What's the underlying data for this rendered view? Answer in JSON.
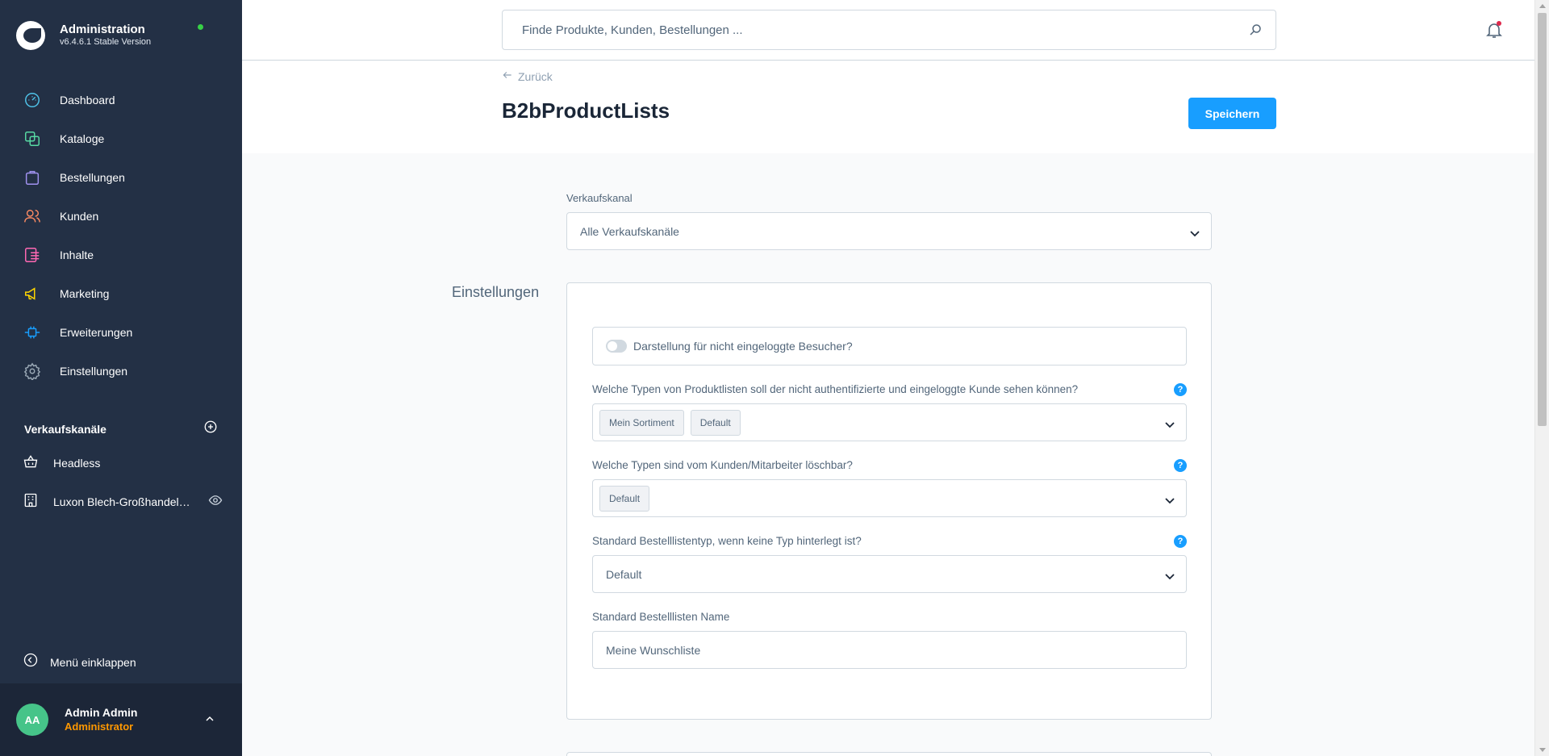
{
  "brand": {
    "title": "Administration",
    "version": "v6.4.6.1 Stable Version",
    "status_color": "#37d046"
  },
  "nav": [
    {
      "label": "Dashboard",
      "icon": "dashboard-icon",
      "color": "#189eff"
    },
    {
      "label": "Kataloge",
      "icon": "catalog-icon",
      "color": "#57d9a3"
    },
    {
      "label": "Bestellungen",
      "icon": "orders-icon",
      "color": "#a092f0"
    },
    {
      "label": "Kunden",
      "icon": "customers-icon",
      "color": "#f88962"
    },
    {
      "label": "Inhalte",
      "icon": "content-icon",
      "color": "#ff68b4"
    },
    {
      "label": "Marketing",
      "icon": "marketing-icon",
      "color": "#ffd700"
    },
    {
      "label": "Erweiterungen",
      "icon": "extensions-icon",
      "color": "#189eff"
    },
    {
      "label": "Einstellungen",
      "icon": "settings-icon",
      "color": "#9aa8b5"
    }
  ],
  "sales_channels": {
    "title": "Verkaufskanäle",
    "items": [
      {
        "label": "Headless",
        "icon": "basket-icon"
      },
      {
        "label": "Luxon Blech-Großhandel GmbH",
        "icon": "storefront-icon"
      }
    ]
  },
  "collapse_label": "Menü einklappen",
  "user": {
    "initials": "AA",
    "name": "Admin Admin",
    "role": "Administrator"
  },
  "search": {
    "placeholder": "Finde Produkte, Kunden, Bestellungen ..."
  },
  "header": {
    "back_label": "Zurück",
    "title": "B2bProductLists",
    "save_label": "Speichern"
  },
  "sales_channel_select": {
    "label": "Verkaufskanal",
    "value": "Alle Verkaufskanäle"
  },
  "settings_card": {
    "title": "Einstellungen",
    "toggle_label": "Darstellung für nicht eingeloggte Besucher?",
    "field1": {
      "label": "Welche Typen von Produktlisten soll der nicht authentifizierte und eingeloggte Kunde sehen können?",
      "tags": [
        "Mein Sortiment",
        "Default"
      ]
    },
    "field2": {
      "label": "Welche Typen sind vom Kunden/Mitarbeiter löschbar?",
      "tags": [
        "Default"
      ]
    },
    "field3": {
      "label": "Standard Bestelllistentyp, wenn keine Typ hinterlegt ist?",
      "value": "Default"
    },
    "field4": {
      "label": "Standard Bestelllisten Name",
      "value": "Meine Wunschliste"
    },
    "help_glyph": "?"
  },
  "colors": {
    "accent": "#189eff",
    "sidebar": "#233045",
    "notification": "#de294c"
  }
}
